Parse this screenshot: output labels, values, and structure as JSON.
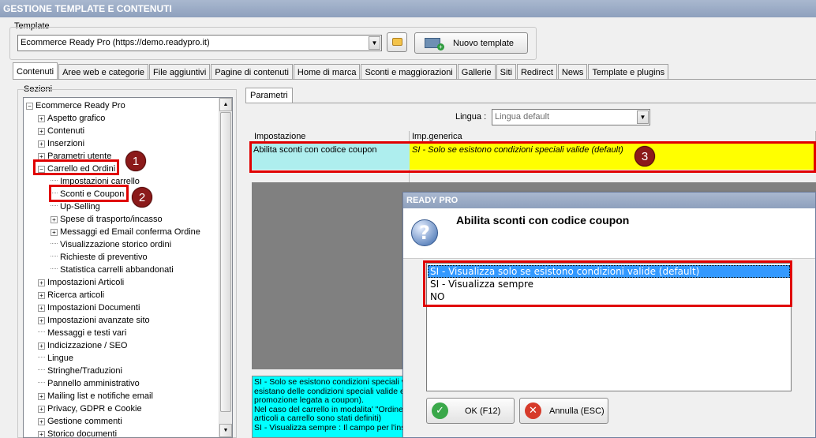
{
  "window": {
    "title": "GESTIONE TEMPLATE E CONTENUTI"
  },
  "template": {
    "group_label": "Template",
    "selected": "Ecommerce Ready Pro (https://demo.readypro.it)",
    "new_button": "Nuovo template"
  },
  "tabs": [
    "Contenuti",
    "Aree web e categorie",
    "File aggiuntivi",
    "Pagine di contenuti",
    "Home di marca",
    "Sconti e maggiorazioni",
    "Gallerie",
    "Siti",
    "Redirect",
    "News",
    "Template e plugins"
  ],
  "sections": {
    "group_label": "Sezioni",
    "root": "Ecommerce Ready Pro",
    "items": [
      "Aspetto grafico",
      "Contenuti",
      "Inserzioni",
      "Parametri utente",
      "Carrello ed Ordini",
      "Impostazioni carrello",
      "Sconti e Coupon",
      "Up-Selling",
      "Spese di trasporto/incasso",
      "Messaggi ed Email conferma Ordine",
      "Visualizzazione storico ordini",
      "Richieste di preventivo",
      "Statistica carrelli abbandonati",
      "Impostazioni Articoli",
      "Ricerca articoli",
      "Impostazioni Documenti",
      "Impostazioni avanzate sito",
      "Messaggi e testi vari",
      "Indicizzazione / SEO",
      "Lingue",
      "Stringhe/Traduzioni",
      "Pannello amministrativo",
      "Mailing list e notifiche email",
      "Privacy, GDPR e Cookie",
      "Gestione commenti",
      "Storico documenti"
    ]
  },
  "params": {
    "tab": "Parametri",
    "lingua_label": "Lingua :",
    "lingua_value": "Lingua default",
    "col_setting": "Impostazione",
    "col_value": "Imp.generica",
    "row_setting": "Abilita sconti con codice coupon",
    "row_value": "SI - Solo se esistono condizioni speciali valide (default)",
    "info_lines": [
      "SI - Solo se esistono condizioni speciali v",
      "esistano delle condizioni speciali valide e",
      "promozione legata a coupon).",
      "Nel caso del carrello in modalita' \"Ordine",
      "articoli a carrello sono stati definiti)",
      "SI - Visualizza sempre : Il campo per l'ins"
    ]
  },
  "badges": [
    "1",
    "2",
    "3"
  ],
  "dialog": {
    "title": "READY PRO",
    "question_icon": "?",
    "heading": "Abilita sconti con codice coupon",
    "options": [
      "SI - Visualizza solo se esistono condizioni valide (default)",
      "SI - Visualizza sempre",
      "NO"
    ],
    "ok": "OK (F12)",
    "cancel": "Annulla (ESC)"
  },
  "colors": {
    "highlight_red": "#e00000",
    "yellow": "#ffff00",
    "cyan": "#00ffff",
    "badge": "#8b1a1a"
  }
}
